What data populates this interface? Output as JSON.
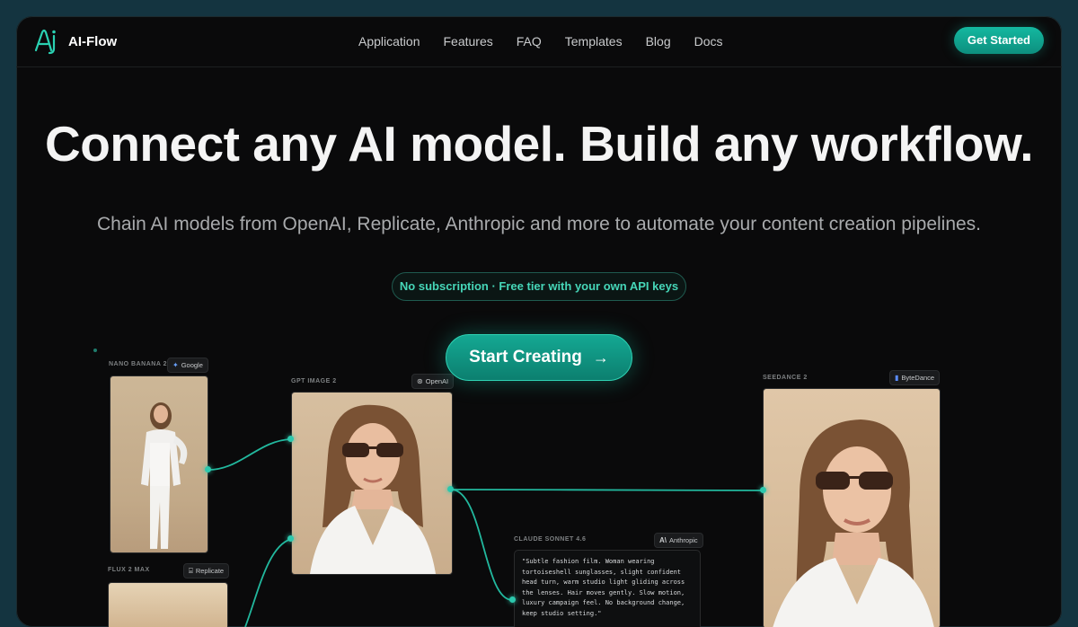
{
  "brand": {
    "name": "AI-Flow",
    "logo_icon": "ai-logo-icon"
  },
  "nav": {
    "items": [
      "Application",
      "Features",
      "FAQ",
      "Templates",
      "Blog",
      "Docs"
    ],
    "cta": "Get Started"
  },
  "hero": {
    "title": "Connect any AI model. Build any workflow.",
    "subtitle": "Chain AI models from OpenAI, Replicate, Anthropic and more to automate your content creation pipelines.",
    "pill": "No subscription · Free tier with your own API keys",
    "button": "Start Creating",
    "button_icon": "arrow-right-icon"
  },
  "canvas": {
    "nodes": [
      {
        "label": "NANO BANANA 2",
        "provider": "Google",
        "icon": "google-sparkle-icon"
      },
      {
        "label": "GPT IMAGE 2",
        "provider": "OpenAI",
        "icon": "openai-icon"
      },
      {
        "label": "SEEDANCE 2",
        "provider": "ByteDance",
        "icon": "bytedance-icon"
      },
      {
        "label": "FLUX 2 MAX",
        "provider": "Replicate",
        "icon": "replicate-icon"
      },
      {
        "label": "CLAUDE SONNET 4.6",
        "provider": "Anthropic",
        "icon": "anthropic-icon"
      }
    ],
    "prompt_text": "\"Subtle fashion film. Woman wearing tortoiseshell sunglasses, slight confident head turn, warm studio light gliding across the lenses. Hair moves gently. Slow motion, luxury campaign feel. No background change, keep studio setting.\""
  },
  "colors": {
    "accent": "#14b8a0",
    "background": "#0a0a0b",
    "page": "#143440"
  }
}
